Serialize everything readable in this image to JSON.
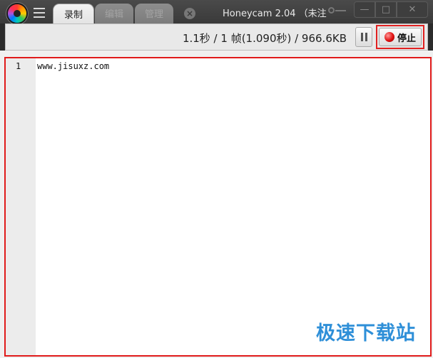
{
  "titlebar": {
    "tabs": [
      {
        "label": "录制",
        "state": "active"
      },
      {
        "label": "编辑",
        "state": "disabled"
      },
      {
        "label": "管理",
        "state": "disabled"
      }
    ],
    "title": "Honeycam 2.04 （未注",
    "icons": {
      "logo": "honeycam-logo-icon",
      "menu": "hamburger-menu-icon",
      "tab_close": "close-circle-icon",
      "key": "key-icon"
    },
    "window_buttons": {
      "minimize": "—",
      "maximize": "□",
      "close": "✕"
    }
  },
  "toolbar": {
    "status": "1.1秒 / 1 帧(1.090秒) / 966.6KB",
    "stop_label": "停止",
    "accent_color": "#e01b1b"
  },
  "editor": {
    "lines": [
      {
        "number": "1",
        "text": "www.jisuxz.com"
      }
    ]
  },
  "watermark": "极速下载站"
}
